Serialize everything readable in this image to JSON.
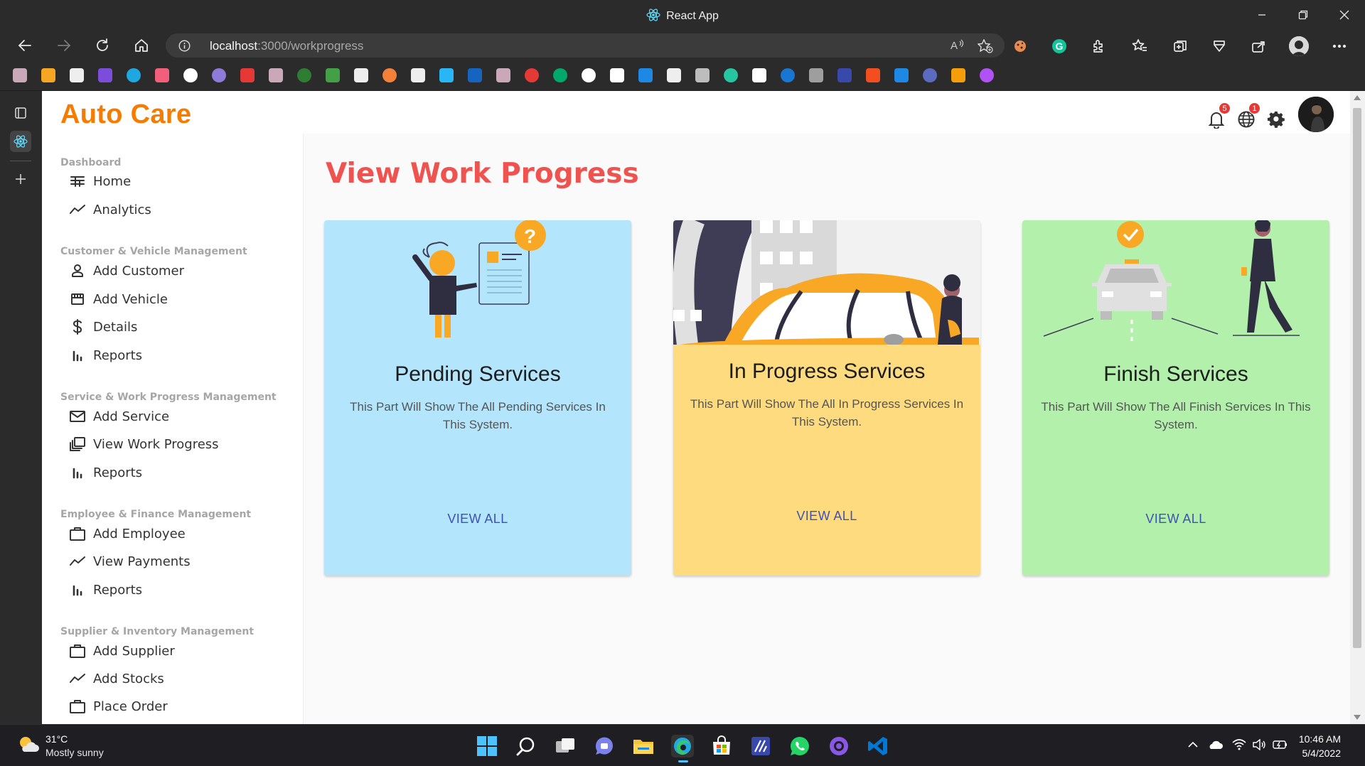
{
  "browser": {
    "tab_title": "React App",
    "url_host": "localhost",
    "url_rest": ":3000/workprogress"
  },
  "app": {
    "brand": "Auto Care",
    "notifications_count": "5",
    "language_count": "1",
    "page_title": "View Work Progress"
  },
  "sidebar": {
    "sections": [
      {
        "title": "Dashboard",
        "items": [
          "Home",
          "Analytics"
        ]
      },
      {
        "title": "Customer & Vehicle Management",
        "items": [
          "Add Customer",
          "Add Vehicle",
          "Details",
          "Reports"
        ]
      },
      {
        "title": "Service & Work Progress Management",
        "items": [
          "Add Service",
          "View Work Progress",
          "Reports"
        ]
      },
      {
        "title": "Employee & Finance Management",
        "items": [
          "Add Employee",
          "View Payments",
          "Reports"
        ]
      },
      {
        "title": "Supplier & Inventory Management",
        "items": [
          "Add Supplier",
          "Add Stocks",
          "Place Order"
        ]
      }
    ]
  },
  "cards": [
    {
      "title": "Pending Services",
      "description": "This Part Will Show The All Pending Services In This System.",
      "button": "VIEW ALL",
      "color": "#b3e5fc"
    },
    {
      "title": "In Progress Services",
      "description": "This Part Will Show The All In Progress Services In This System.",
      "button": "VIEW ALL",
      "color": "#ffdb80"
    },
    {
      "title": "Finish Services",
      "description": "This Part Will Show The All Finish Services In This System.",
      "button": "VIEW ALL",
      "color": "#b2f0ac"
    }
  ],
  "colors": {
    "brand": "#f57c00",
    "title": "#ef5350",
    "link": "#3f51b5"
  },
  "taskbar": {
    "temperature": "31°C",
    "condition": "Mostly sunny",
    "time": "10:46 AM",
    "date": "5/4/2022"
  }
}
